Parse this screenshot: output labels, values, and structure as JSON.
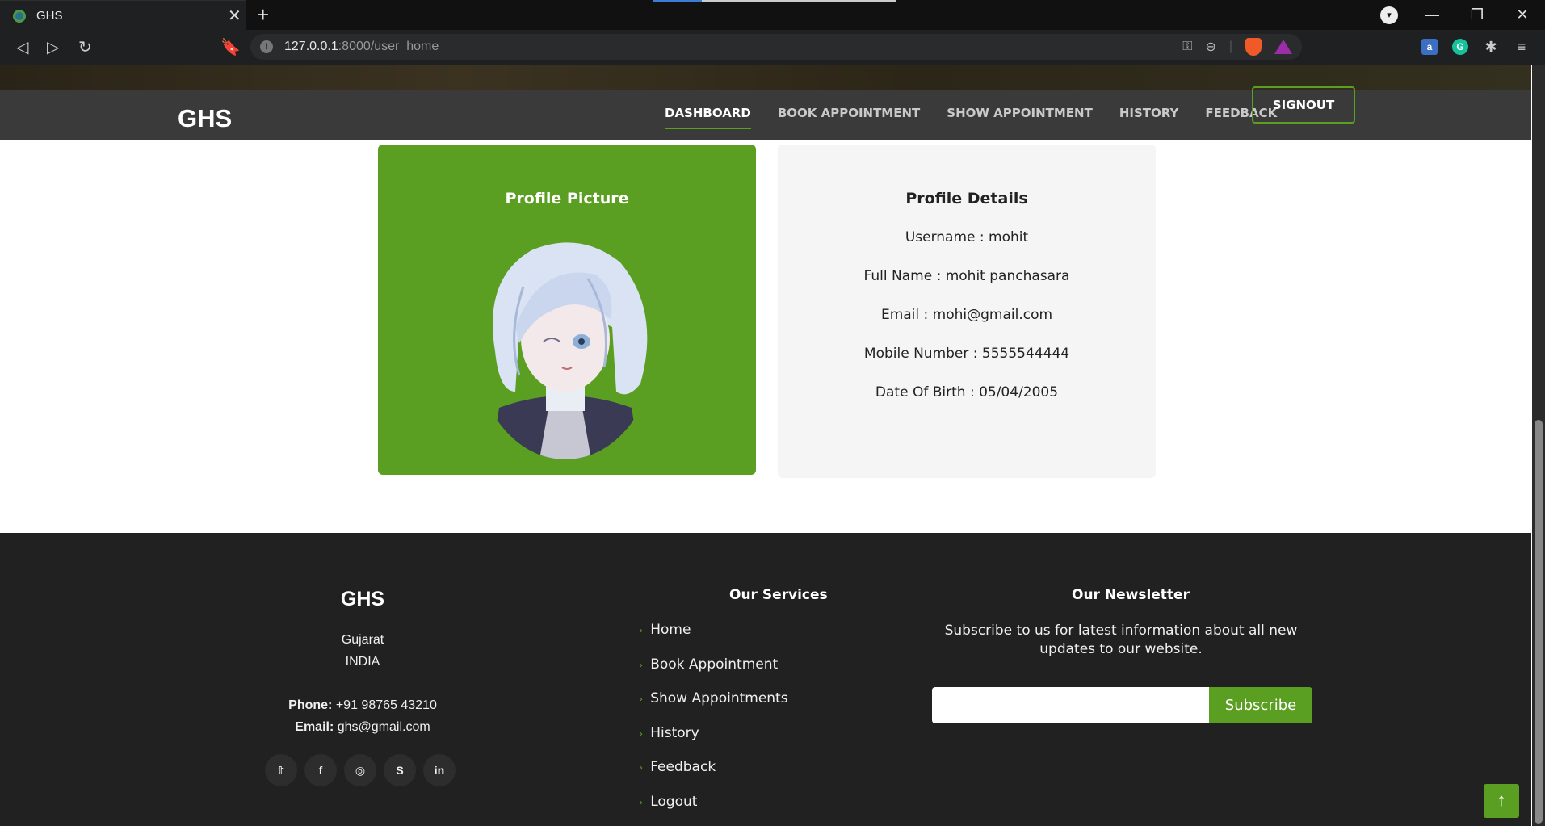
{
  "browser": {
    "tab_title": "GHS",
    "new_tab": "+",
    "url_host": "127.0.0.1",
    "url_rest": ":8000/user_home"
  },
  "header": {
    "brand": "GHS",
    "nav": [
      "DASHBOARD",
      "BOOK APPOINTMENT",
      "SHOW APPOINTMENT",
      "HISTORY",
      "FEEDBACK"
    ],
    "signout": "SIGNOUT"
  },
  "profile_picture": {
    "title": "Profile Picture"
  },
  "profile_details": {
    "title": "Profile Details",
    "username": "Username : mohit",
    "full_name": "Full Name : mohit panchasara",
    "email": "Email : mohi@gmail.com",
    "mobile": "Mobile Number : 5555544444",
    "dob": "Date Of Birth : 05/04/2005"
  },
  "footer": {
    "brand": "GHS",
    "state": "Gujarat",
    "country": "INDIA",
    "phone_label": "Phone:",
    "phone": "+91 98765 43210",
    "email_label": "Email:",
    "email": "ghs@gmail.com",
    "services_title": "Our Services",
    "services": [
      "Home",
      "Book Appointment",
      "Show Appointments",
      "History",
      "Feedback",
      "Logout"
    ],
    "newsletter_title": "Our Newsletter",
    "newsletter_text": "Subscribe to us for latest information about all new updates to our website.",
    "subscribe": "Subscribe"
  },
  "colors": {
    "accent": "#5a9e22",
    "header_bg": "#3a3a3a",
    "footer_bg": "#212121"
  }
}
